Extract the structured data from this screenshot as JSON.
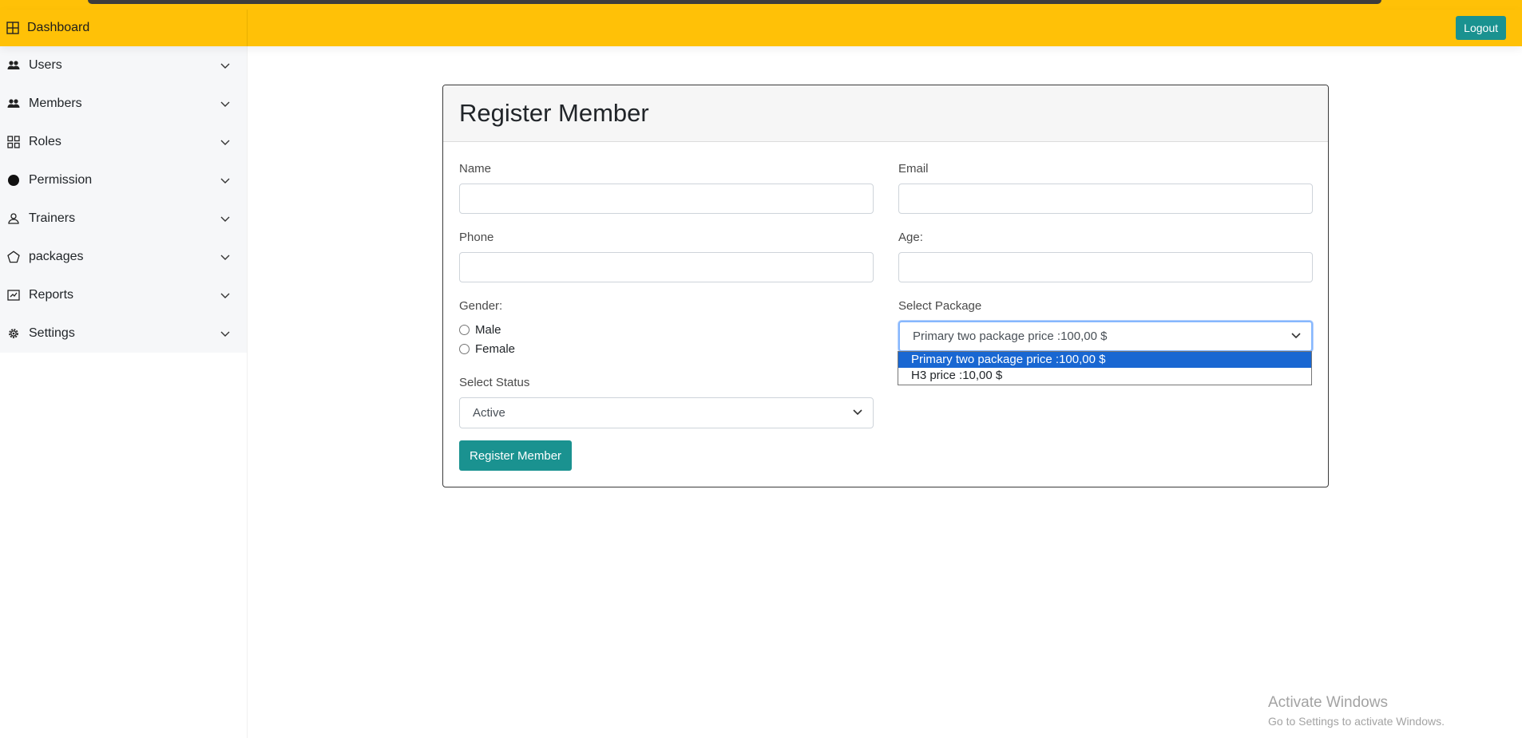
{
  "topbar": {
    "brand_label": "Dashboard",
    "brand_icon": "dashboard-grid-icon",
    "logout_label": "Logout",
    "background_color": "#ffc107",
    "accent_color": "#1a9290"
  },
  "sidebar": {
    "items": [
      {
        "label": "Users",
        "icon": "users-icon"
      },
      {
        "label": "Members",
        "icon": "members-icon"
      },
      {
        "label": "Roles",
        "icon": "roles-grid-icon"
      },
      {
        "label": "Permission",
        "icon": "permission-circle-icon"
      },
      {
        "label": "Trainers",
        "icon": "trainer-person-icon"
      },
      {
        "label": "packages",
        "icon": "package-pentagon-icon"
      },
      {
        "label": "Reports",
        "icon": "reports-icon"
      },
      {
        "label": "Settings",
        "icon": "settings-gear-icon"
      }
    ]
  },
  "form": {
    "title": "Register Member",
    "name_label": "Name",
    "name_value": "",
    "email_label": "Email",
    "email_value": "",
    "phone_label": "Phone",
    "phone_value": "",
    "age_label": "Age:",
    "age_value": "",
    "gender_label": "Gender:",
    "gender_options": [
      "Male",
      "Female"
    ],
    "package_label": "Select Package",
    "package_selected": "Primary two package price :100,00 $",
    "package_options": [
      "Primary two package price :100,00 $",
      "H3 price :10,00 $"
    ],
    "status_label": "Select Status",
    "status_selected": "Active",
    "submit_label": "Register Member"
  },
  "watermark": {
    "line1": "Activate Windows",
    "line2": "Go to Settings to activate Windows."
  }
}
